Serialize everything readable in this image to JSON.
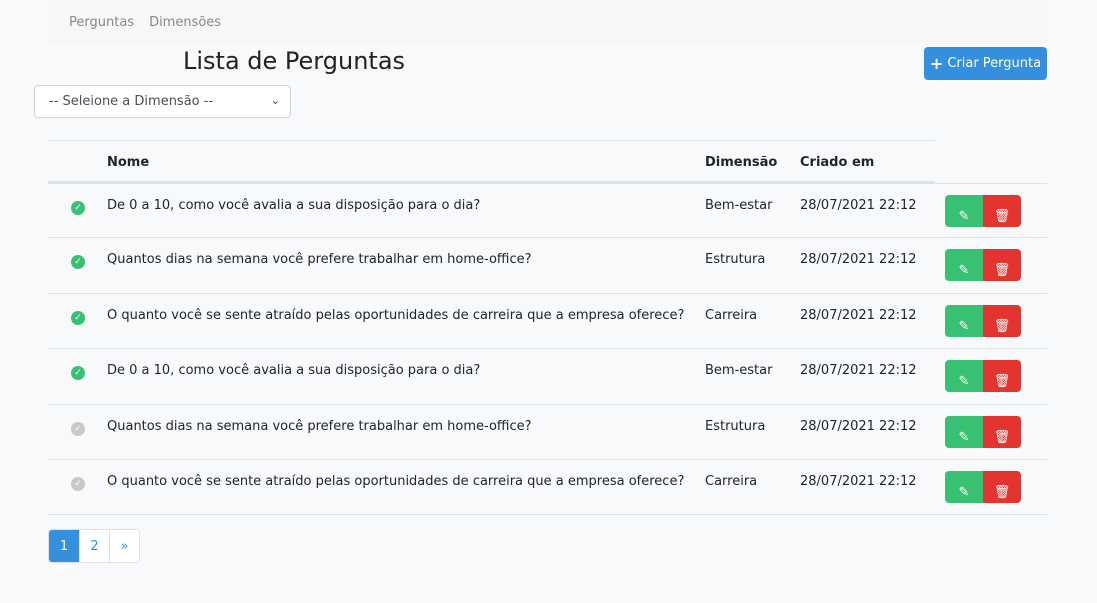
{
  "nav": {
    "items": [
      "Perguntas",
      "Dimensões"
    ]
  },
  "page": {
    "title": "Lista de Perguntas",
    "create_label": "Criar Pergunta"
  },
  "filter": {
    "selected": "-- Seleione a Dimensão --"
  },
  "table": {
    "headers": [
      "Nome",
      "Dimensão",
      "Criado em"
    ],
    "rows": [
      {
        "active": true,
        "nome": "De 0 a 10, como você avalia a sua disposição para o dia?",
        "dimensao": "Bem-estar",
        "criado": "28/07/2021 22:12"
      },
      {
        "active": true,
        "nome": "Quantos dias na semana você prefere trabalhar em home-office?",
        "dimensao": "Estrutura",
        "criado": "28/07/2021 22:12"
      },
      {
        "active": true,
        "nome": "O quanto você se sente atraído pelas oportunidades de carreira que a empresa oferece?",
        "dimensao": "Carreira",
        "criado": "28/07/2021 22:12"
      },
      {
        "active": true,
        "nome": "De 0 a 10, como você avalia a sua disposição para o dia?",
        "dimensao": "Bem-estar",
        "criado": "28/07/2021 22:12"
      },
      {
        "active": false,
        "nome": "Quantos dias na semana você prefere trabalhar em home-office?",
        "dimensao": "Estrutura",
        "criado": "28/07/2021 22:12"
      },
      {
        "active": false,
        "nome": "O quanto você se sente atraído pelas oportunidades de carreira que a empresa oferece?",
        "dimensao": "Carreira",
        "criado": "28/07/2021 22:12"
      }
    ]
  },
  "pagination": {
    "pages": [
      "1",
      "2"
    ],
    "next": "»",
    "current": "1"
  },
  "colors": {
    "primary": "#3490dc",
    "success": "#38c172",
    "danger": "#e3342f",
    "inactive": "#c8c8c8"
  }
}
